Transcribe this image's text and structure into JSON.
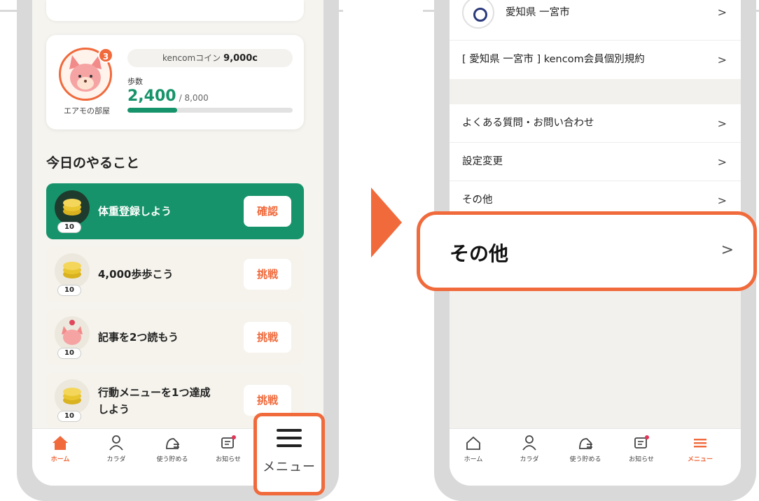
{
  "left_screen": {
    "avatar_badge": "3",
    "avatar_label": "エアモの部屋",
    "coins_label": "kencomコイン",
    "coins_value": "9,000c",
    "steps_label": "歩数",
    "steps_value": "2,400",
    "steps_goal": "/ 8,000",
    "steps_progress": 0.3,
    "section_title": "今日のやること",
    "tasks": [
      {
        "text": "体重登録しよう",
        "points": "10",
        "button": "確認"
      },
      {
        "text": "4,000歩歩こう",
        "points": "10",
        "button": "挑戦"
      },
      {
        "text": "記事を2つ読もう",
        "points": "10",
        "button": "挑戦"
      },
      {
        "text_line1": "行動メニューを1つ達成",
        "text_line2": "しよう",
        "points": "10",
        "button": "挑戦"
      }
    ],
    "tabs": [
      "ホーム",
      "カラダ",
      "使う貯める",
      "お知らせ"
    ],
    "menu_callout_label": "メニュー"
  },
  "right_screen": {
    "org_name": "愛知県 一宮市",
    "terms_label": "[ 愛知県 一宮市 ] kencom会員個別規約",
    "faq_label": "よくある質問・お問い合わせ",
    "settings_label": "設定変更",
    "other_label": "その他",
    "tabs": [
      "ホーム",
      "カラダ",
      "使う貯める",
      "お知らせ",
      "メニュー"
    ]
  },
  "callout_other_label": "その他",
  "chevron": ">",
  "colors": {
    "accent": "#f06a3c",
    "green": "#16936a"
  }
}
